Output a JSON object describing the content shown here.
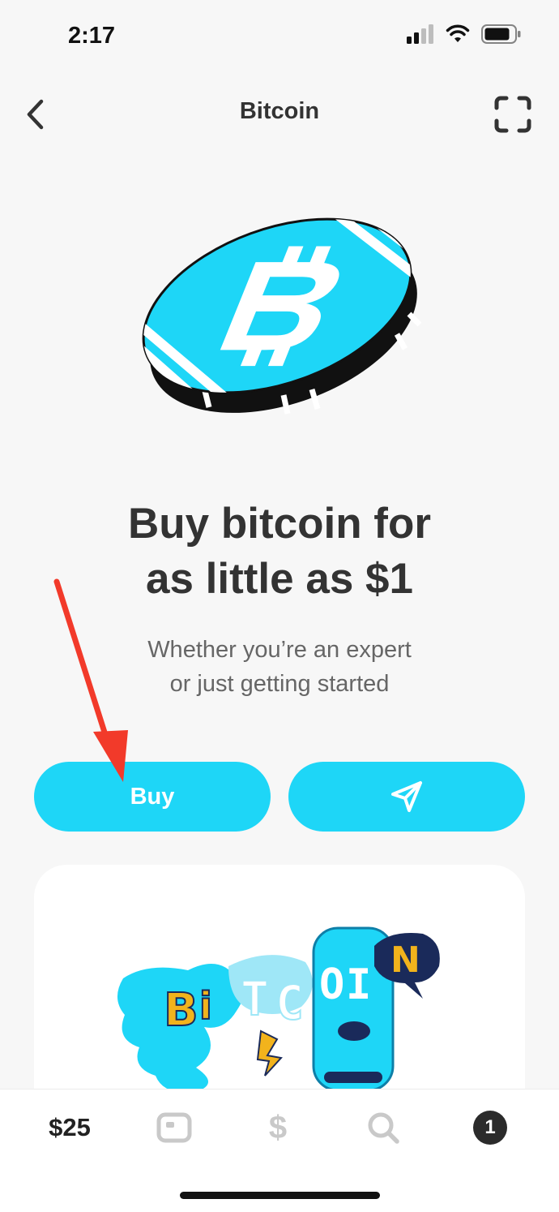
{
  "status_bar": {
    "time": "2:17"
  },
  "nav": {
    "title": "Bitcoin",
    "back_icon": "chevron-left-icon",
    "scan_icon": "scan-frame-icon"
  },
  "hero": {
    "headline_line1": "Buy bitcoin for",
    "headline_line2": "as little as $1",
    "subtitle_line1": "Whether you’re an expert",
    "subtitle_line2": "or just getting started"
  },
  "actions": {
    "buy_label": "Buy",
    "send_icon": "paper-plane-icon"
  },
  "promo_card": {
    "illustration_letters": [
      "B",
      "i",
      "T",
      "C",
      "O",
      "I",
      "N"
    ]
  },
  "tabbar": {
    "balance": "$25",
    "cash_symbol": "$",
    "activity_count": "1"
  },
  "colors": {
    "accent": "#1ed6f7",
    "arrow": "#f23a2a",
    "text": "#333333"
  }
}
